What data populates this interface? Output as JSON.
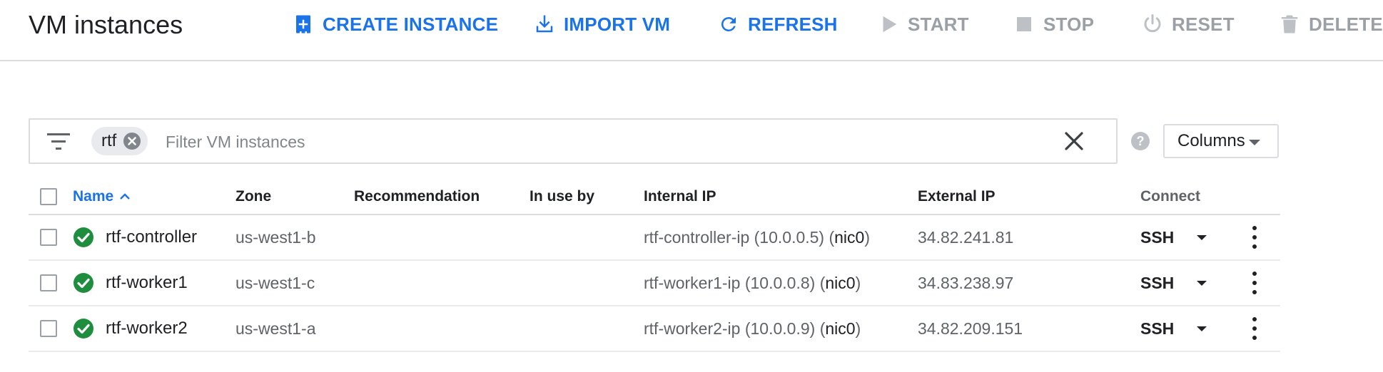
{
  "header": {
    "title": "VM instances",
    "actions": [
      {
        "label": "CREATE INSTANCE",
        "icon": "create-instance-icon",
        "enabled": true
      },
      {
        "label": "IMPORT VM",
        "icon": "import-icon",
        "enabled": true
      },
      {
        "label": "REFRESH",
        "icon": "refresh-icon",
        "enabled": true
      },
      {
        "label": "START",
        "icon": "play-icon",
        "enabled": false
      },
      {
        "label": "STOP",
        "icon": "stop-icon",
        "enabled": false
      },
      {
        "label": "RESET",
        "icon": "power-icon",
        "enabled": false
      },
      {
        "label": "DELETE",
        "icon": "trash-icon",
        "enabled": false
      }
    ]
  },
  "filter": {
    "chip": "rtf",
    "placeholder": "Filter VM instances",
    "value": ""
  },
  "columns_button": "Columns",
  "table": {
    "headers": {
      "name": "Name",
      "zone": "Zone",
      "recommendation": "Recommendation",
      "in_use_by": "In use by",
      "internal_ip": "Internal IP",
      "external_ip": "External IP",
      "connect": "Connect"
    },
    "sort": {
      "column": "name",
      "direction": "ascending"
    },
    "rows": [
      {
        "name": "rtf-controller",
        "status": "running",
        "zone": "us-west1-b",
        "recommendation": "",
        "in_use_by": "",
        "internal_ip": "rtf-controller-ip (10.0.0.5) (",
        "nic": "nic0",
        "nic_close": ")",
        "external_ip": "34.82.241.81",
        "connect": "SSH"
      },
      {
        "name": "rtf-worker1",
        "status": "running",
        "zone": "us-west1-c",
        "recommendation": "",
        "in_use_by": "",
        "internal_ip": "rtf-worker1-ip (10.0.0.8) (",
        "nic": "nic0",
        "nic_close": ")",
        "external_ip": "34.83.238.97",
        "connect": "SSH"
      },
      {
        "name": "rtf-worker2",
        "status": "running",
        "zone": "us-west1-a",
        "recommendation": "",
        "in_use_by": "",
        "internal_ip": "rtf-worker2-ip (10.0.0.9) (",
        "nic": "nic0",
        "nic_close": ")",
        "external_ip": "34.82.209.151",
        "connect": "SSH"
      }
    ]
  },
  "colors": {
    "accent": "#1a73e8",
    "disabled": "#9aa0a6",
    "status_ok": "#1e8e3e",
    "border": "#dadce0"
  }
}
